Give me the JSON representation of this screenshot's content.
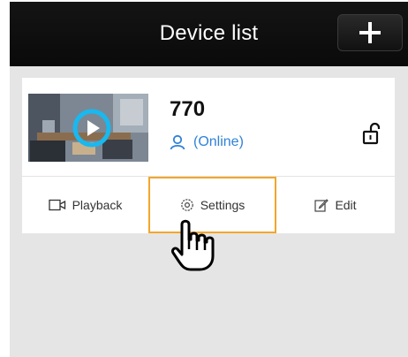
{
  "header": {
    "title": "Device list",
    "add_button": "+"
  },
  "device": {
    "name": "770",
    "status": "(Online)",
    "status_color": "#2f82d8"
  },
  "actions": {
    "playback": "Playback",
    "settings": "Settings",
    "edit": "Edit",
    "highlight_color": "#f3a62b"
  },
  "icons": {
    "add": "plus-icon",
    "play": "play-icon",
    "user": "user-icon",
    "lock": "unlocked-padlock-icon",
    "playback": "video-camera-icon",
    "settings": "gear-icon",
    "edit": "edit-pencil-icon",
    "cursor": "pointing-hand-icon"
  }
}
